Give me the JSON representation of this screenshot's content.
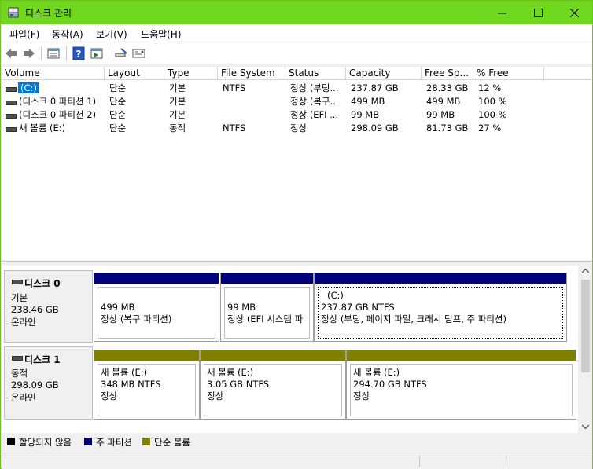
{
  "window": {
    "title": "디스크 관리"
  },
  "menu": [
    "파일(F)",
    "동작(A)",
    "보기(V)",
    "도움말(H)"
  ],
  "toolbar_icons": [
    "back-icon",
    "forward-icon",
    "list-view-icon",
    "help-icon",
    "properties-icon",
    "connect-icon",
    "rescan-icon"
  ],
  "columns": [
    "Volume",
    "Layout",
    "Type",
    "File System",
    "Status",
    "Capacity",
    "Free Sp...",
    "% Free"
  ],
  "volumes": [
    {
      "volume": "(C:)",
      "layout": "단순",
      "type": "기본",
      "fs": "NTFS",
      "status": "정상 (부팅...",
      "capacity": "237.87 GB",
      "free": "28.33 GB",
      "pct": "12 %"
    },
    {
      "volume": "(디스크 0 파티션 1)",
      "layout": "단순",
      "type": "기본",
      "fs": "",
      "status": "정상 (복구...",
      "capacity": "499 MB",
      "free": "499 MB",
      "pct": "100 %"
    },
    {
      "volume": "(디스크 0 파티션 2)",
      "layout": "단순",
      "type": "기본",
      "fs": "",
      "status": "정상 (EFI ...",
      "capacity": "99 MB",
      "free": "99 MB",
      "pct": "100 %"
    },
    {
      "volume": "새 볼륨 (E:)",
      "layout": "단순",
      "type": "동적",
      "fs": "NTFS",
      "status": "정상",
      "capacity": "298.09 GB",
      "free": "81.73 GB",
      "pct": "27 %"
    }
  ],
  "disks": [
    {
      "name": "디스크 0",
      "type": "기본",
      "size": "238.46 GB",
      "state": "온라인",
      "partitions": [
        {
          "title": "",
          "size": "499 MB",
          "status": "정상 (복구 파티션)"
        },
        {
          "title": "",
          "size": "99 MB",
          "status": "정상 (EFI 시스템 파"
        },
        {
          "title": "(C:)",
          "size": "237.87 GB NTFS",
          "status": "정상 (부팅, 페이지 파일, 크래시 덤프, 주 파티션)"
        }
      ]
    },
    {
      "name": "디스크 1",
      "type": "동적",
      "size": "298.09 GB",
      "state": "온라인",
      "partitions": [
        {
          "title": "새 볼륨  (E:)",
          "size": "348 MB NTFS",
          "status": "정상"
        },
        {
          "title": "새 볼륨  (E:)",
          "size": "3.05 GB NTFS",
          "status": "정상"
        },
        {
          "title": "새 볼륨  (E:)",
          "size": "294.70 GB NTFS",
          "status": "정상"
        }
      ]
    }
  ],
  "legend": [
    {
      "label": "할당되지 않음",
      "color": "#000000"
    },
    {
      "label": "주 파티션",
      "color": "#00007b"
    },
    {
      "label": "단순 볼륨",
      "color": "#808000"
    }
  ],
  "colors": {
    "titlebar": "#6fd81e",
    "primary_partition": "#00007b",
    "simple_volume": "#808000",
    "selection": "#0078d7"
  }
}
